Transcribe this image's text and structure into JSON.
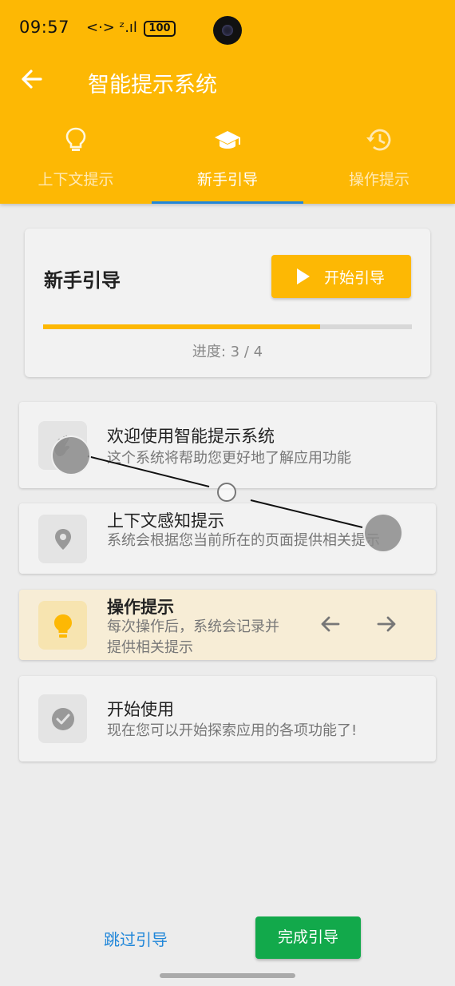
{
  "status": {
    "time": "09:57",
    "signal": "<·> ᶻ.ıl",
    "battery": "100"
  },
  "header": {
    "title": "智能提示系统"
  },
  "tabs": [
    {
      "label": "上下文提示",
      "icon": "lightbulb-icon"
    },
    {
      "label": "新手引导",
      "icon": "graduation-cap-icon"
    },
    {
      "label": "操作提示",
      "icon": "history-icon"
    }
  ],
  "guide": {
    "title": "新手引导",
    "start_label": "开始引导",
    "progress_text": "进度: 3 / 4",
    "progress_value": 0.75
  },
  "steps": [
    {
      "title": "欢迎使用智能提示系统",
      "desc": "这个系统将帮助您更好地了解应用功能",
      "icon": "waving-hand-icon"
    },
    {
      "title": "上下文感知提示",
      "desc": "系统会根据您当前所在的页面提供相关提示",
      "icon": "location-pin-icon"
    },
    {
      "title": "操作提示",
      "desc": "每次操作后，系统会记录并提供相关提示",
      "icon": "lightbulb-icon"
    },
    {
      "title": "开始使用",
      "desc": "现在您可以开始探索应用的各项功能了!",
      "icon": "check-circle-icon"
    }
  ],
  "footer": {
    "skip_label": "跳过引导",
    "done_label": "完成引导"
  },
  "colors": {
    "accent": "#fdb804",
    "tab_indicator": "#1f86d9",
    "done": "#12a94b"
  }
}
